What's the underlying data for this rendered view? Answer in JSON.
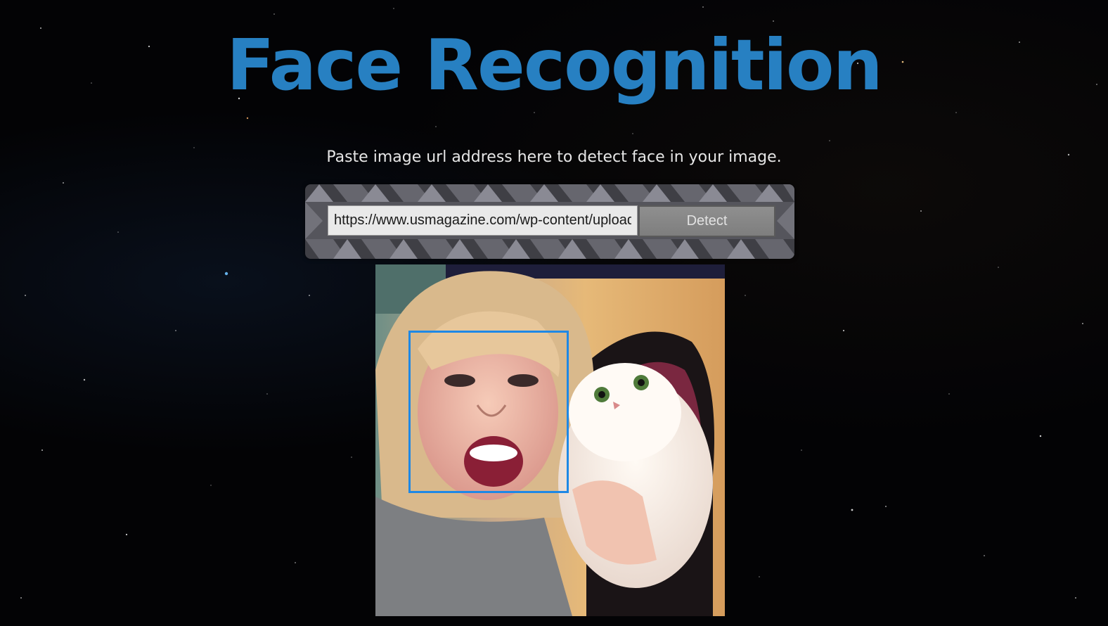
{
  "app": {
    "title": "Face Recognition",
    "subtitle": "Paste image url address here to detect face in your image."
  },
  "form": {
    "url_value": "https://www.usmagazine.com/wp-content/uploads",
    "detect_label": "Detect"
  },
  "result": {
    "image_alt": "selfie-with-cat-photo",
    "face_count": 1
  },
  "colors": {
    "title": "#2780c2",
    "face_box": "#1e88e5",
    "background": "#030305"
  }
}
